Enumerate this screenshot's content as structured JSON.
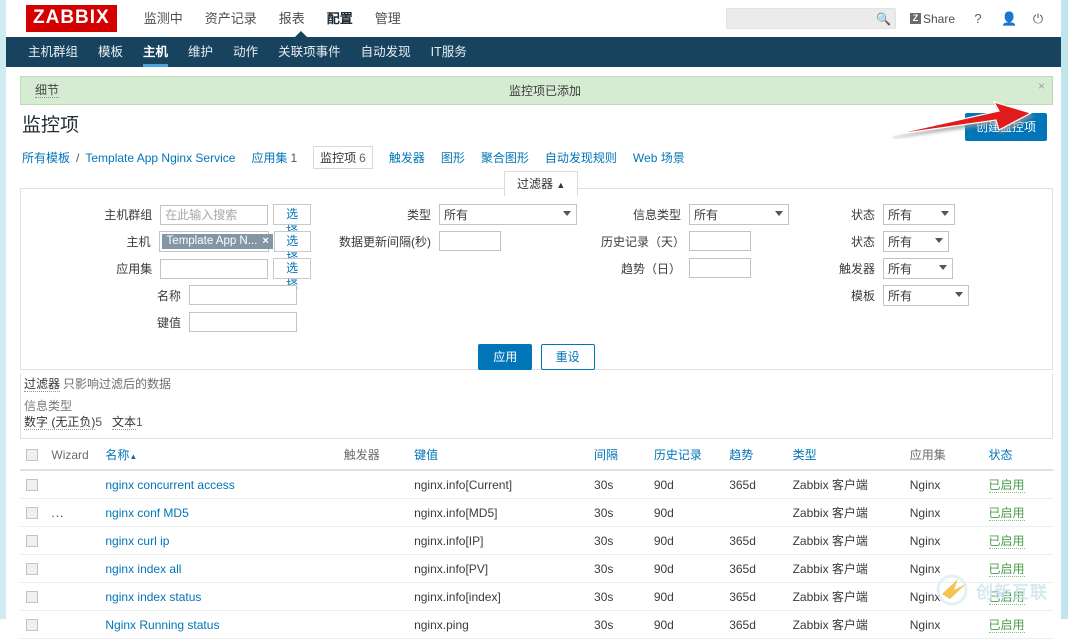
{
  "brand": {
    "logo": "ZABBIX"
  },
  "topnav": {
    "items": [
      {
        "label": "监测中",
        "active": false
      },
      {
        "label": "资产记录",
        "active": false
      },
      {
        "label": "报表",
        "active": false
      },
      {
        "label": "配置",
        "active": true
      },
      {
        "label": "管理",
        "active": false
      }
    ],
    "search_placeholder": "",
    "search_value": "",
    "share_label": "Share",
    "help_icon": "?",
    "user_icon": "user-icon",
    "signout_icon": "power-icon"
  },
  "subnav": {
    "items": [
      {
        "label": "主机群组",
        "active": false
      },
      {
        "label": "模板",
        "active": false
      },
      {
        "label": "主机",
        "active": true
      },
      {
        "label": "维护",
        "active": false
      },
      {
        "label": "动作",
        "active": false
      },
      {
        "label": "关联项事件",
        "active": false
      },
      {
        "label": "自动发现",
        "active": false
      },
      {
        "label": "IT服务",
        "active": false
      }
    ]
  },
  "message": {
    "details_label": "细节",
    "text": "监控项已添加",
    "close": "×"
  },
  "page": {
    "title": "监控项",
    "create_button": "创建监控项"
  },
  "breadcrumb": {
    "all_templates": "所有模板",
    "separator": "/",
    "template_name": "Template App Nginx Service",
    "tabs": [
      {
        "label": "应用集",
        "count": "1",
        "current": false
      },
      {
        "label": "监控项",
        "count": "6",
        "current": true
      },
      {
        "label": "触发器",
        "count": "",
        "current": false
      },
      {
        "label": "图形",
        "count": "",
        "current": false
      },
      {
        "label": "聚合图形",
        "count": "",
        "current": false
      },
      {
        "label": "自动发现规则",
        "count": "",
        "current": false
      },
      {
        "label": "Web 场景",
        "count": "",
        "current": false
      }
    ]
  },
  "filter": {
    "tab_label": "过滤器",
    "tab_caret": "▲",
    "host_group": {
      "label": "主机群组",
      "placeholder": "在此输入搜索",
      "value": "",
      "select_button": "选择"
    },
    "host": {
      "label": "主机",
      "chip": "Template App N...",
      "chip_remove": "×",
      "select_button": "选择"
    },
    "application": {
      "label": "应用集",
      "value": "",
      "select_button": "选择"
    },
    "name": {
      "label": "名称",
      "value": ""
    },
    "key": {
      "label": "键值",
      "value": ""
    },
    "type": {
      "label": "类型",
      "value": "所有"
    },
    "update_interval": {
      "label": "数据更新间隔(秒)",
      "value": ""
    },
    "value_type": {
      "label": "信息类型",
      "value": "所有"
    },
    "history": {
      "label": "历史记录（天）",
      "value": ""
    },
    "trends": {
      "label": "趋势（日）",
      "value": ""
    },
    "status": {
      "label": "状态",
      "value": "所有"
    },
    "state": {
      "label": "状态",
      "value": "所有"
    },
    "triggers": {
      "label": "触发器",
      "value": "所有"
    },
    "template": {
      "label": "模板",
      "value": "所有"
    },
    "apply_button": "应用",
    "reset_button": "重设"
  },
  "filter_summary": {
    "title": "过滤器",
    "note": "只影响过滤后的数据",
    "section_label": "信息类型",
    "items": [
      {
        "label": "数字 (无正负)",
        "count": "5"
      },
      {
        "label": "文本",
        "count": "1"
      }
    ]
  },
  "table": {
    "columns": [
      {
        "key": "checkbox",
        "label": "",
        "link": false
      },
      {
        "key": "wizard",
        "label": "Wizard",
        "link": false
      },
      {
        "key": "name",
        "label": "名称",
        "link": true,
        "sort": "▲"
      },
      {
        "key": "triggers",
        "label": "触发器",
        "link": false
      },
      {
        "key": "key",
        "label": "键值",
        "link": true
      },
      {
        "key": "interval",
        "label": "间隔",
        "link": true
      },
      {
        "key": "history",
        "label": "历史记录",
        "link": true
      },
      {
        "key": "trends",
        "label": "趋势",
        "link": true
      },
      {
        "key": "type",
        "label": "类型",
        "link": true
      },
      {
        "key": "application",
        "label": "应用集",
        "link": false
      },
      {
        "key": "status",
        "label": "状态",
        "link": true
      }
    ],
    "rows": [
      {
        "wizard": "",
        "name": "nginx concurrent access",
        "triggers": "",
        "key": "nginx.info[Current]",
        "interval": "30s",
        "history": "90d",
        "trends": "365d",
        "type": "Zabbix 客户端",
        "application": "Nginx",
        "status": "已启用"
      },
      {
        "wizard": "...",
        "name": "nginx conf MD5",
        "triggers": "",
        "key": "nginx.info[MD5]",
        "interval": "30s",
        "history": "90d",
        "trends": "",
        "type": "Zabbix 客户端",
        "application": "Nginx",
        "status": "已启用"
      },
      {
        "wizard": "",
        "name": "nginx curl ip",
        "triggers": "",
        "key": "nginx.info[IP]",
        "interval": "30s",
        "history": "90d",
        "trends": "365d",
        "type": "Zabbix 客户端",
        "application": "Nginx",
        "status": "已启用"
      },
      {
        "wizard": "",
        "name": "nginx index all",
        "triggers": "",
        "key": "nginx.info[PV]",
        "interval": "30s",
        "history": "90d",
        "trends": "365d",
        "type": "Zabbix 客户端",
        "application": "Nginx",
        "status": "已启用"
      },
      {
        "wizard": "",
        "name": "nginx index status",
        "triggers": "",
        "key": "nginx.info[index]",
        "interval": "30s",
        "history": "90d",
        "trends": "365d",
        "type": "Zabbix 客户端",
        "application": "Nginx",
        "status": "已启用"
      },
      {
        "wizard": "",
        "name": "Nginx Running status",
        "triggers": "",
        "key": "nginx.ping",
        "interval": "30s",
        "history": "90d",
        "trends": "365d",
        "type": "Zabbix 客户端",
        "application": "Nginx",
        "status": "已启用"
      }
    ]
  },
  "watermark": {
    "text": "创新互联"
  },
  "colors": {
    "brand_red": "#d40000",
    "nav_dark": "#18435e",
    "accent_blue": "#0275b8",
    "success_green": "#4a9c4a",
    "banner_green": "#d6ecd2",
    "annotation_red": "#e01b1b"
  }
}
